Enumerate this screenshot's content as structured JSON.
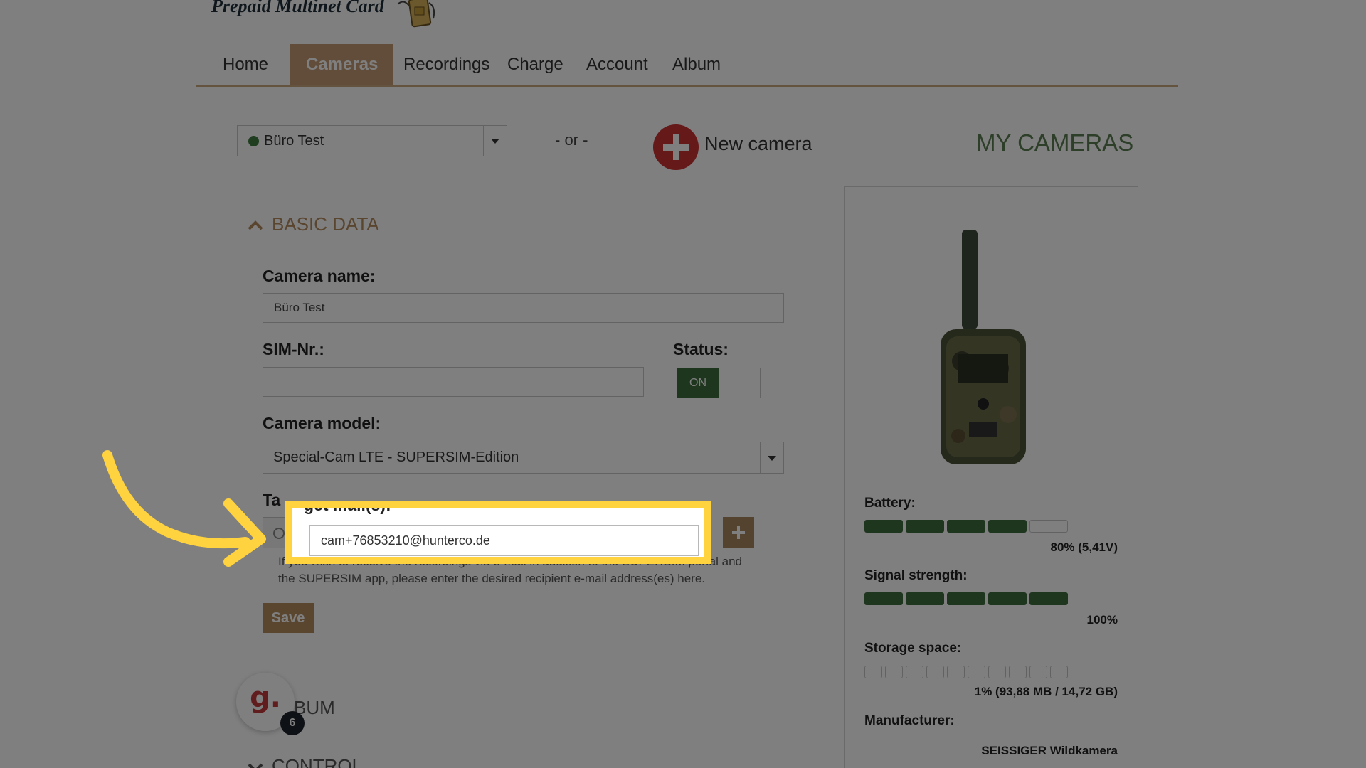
{
  "header": {
    "brand": "Prepaid Multinet Card"
  },
  "nav": {
    "items": [
      {
        "label": "Home"
      },
      {
        "label": "Cameras"
      },
      {
        "label": "Recordings"
      },
      {
        "label": "Charge"
      },
      {
        "label": "Account"
      },
      {
        "label": "Album"
      }
    ],
    "active": "Cameras"
  },
  "camera_select": {
    "value": "Büro Test"
  },
  "or_text": "- or -",
  "new_camera": {
    "label": "New camera"
  },
  "page_title": "MY CAMERAS",
  "basic_data": {
    "heading": "BASIC DATA",
    "camera_name_label": "Camera name:",
    "camera_name_value": "Büro Test",
    "sim_label": "SIM-Nr.:",
    "sim_value": "",
    "status_label": "Status:",
    "status_toggle": "ON",
    "model_label": "Camera model:",
    "model_value": "Special-Cam LTE - SUPERSIM-Edition",
    "mail_label": "Target mail(s):",
    "mail_label_visible": "Ta",
    "mail_label_fragment": "get mail(s):",
    "mail_value": "cam+76853210@hunterco.de",
    "help_text": "If you wish to receive the recordings via e-mail in addition to the SUPERSIM portal and the SUPERSIM app, please enter the desired recipient e-mail address(es) here.",
    "save_label": "Save"
  },
  "album_heading": "BUM",
  "control_heading": "CONTROL",
  "badge": {
    "letter": "g.",
    "count": "6"
  },
  "camera_status": {
    "battery_label": "Battery:",
    "battery_value": "80% (5,41V)",
    "battery_level": 0.8,
    "signal_label": "Signal strength:",
    "signal_value": "100%",
    "signal_level": 1.0,
    "storage_label": "Storage space:",
    "storage_value": "1% (93,88 MB / 14,72 GB)",
    "storage_level": 0.01,
    "manufacturer_label": "Manufacturer:",
    "manufacturer_value": "SEISSIGER Wildkamera"
  },
  "colors": {
    "accent": "#c29b73",
    "status_green": "#3c6a3c",
    "highlight": "#ffd23f",
    "brand_red": "#cc3333"
  }
}
